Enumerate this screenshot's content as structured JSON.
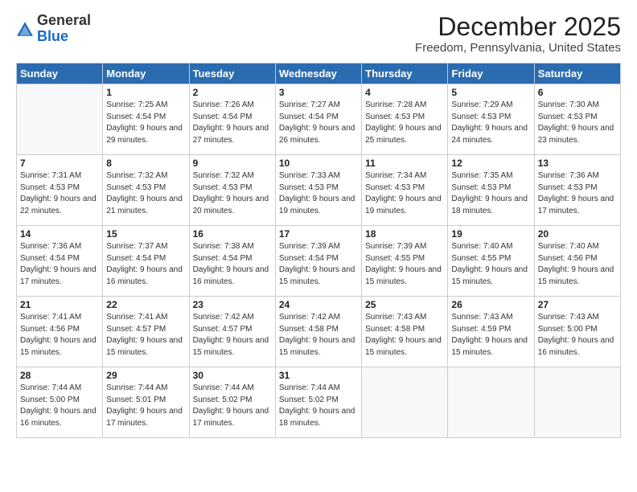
{
  "header": {
    "logo_general": "General",
    "logo_blue": "Blue",
    "month_title": "December 2025",
    "location": "Freedom, Pennsylvania, United States"
  },
  "days_of_week": [
    "Sunday",
    "Monday",
    "Tuesday",
    "Wednesday",
    "Thursday",
    "Friday",
    "Saturday"
  ],
  "weeks": [
    [
      {
        "day": "",
        "info": ""
      },
      {
        "day": "1",
        "info": "Sunrise: 7:25 AM\nSunset: 4:54 PM\nDaylight: 9 hours\nand 29 minutes."
      },
      {
        "day": "2",
        "info": "Sunrise: 7:26 AM\nSunset: 4:54 PM\nDaylight: 9 hours\nand 27 minutes."
      },
      {
        "day": "3",
        "info": "Sunrise: 7:27 AM\nSunset: 4:54 PM\nDaylight: 9 hours\nand 26 minutes."
      },
      {
        "day": "4",
        "info": "Sunrise: 7:28 AM\nSunset: 4:53 PM\nDaylight: 9 hours\nand 25 minutes."
      },
      {
        "day": "5",
        "info": "Sunrise: 7:29 AM\nSunset: 4:53 PM\nDaylight: 9 hours\nand 24 minutes."
      },
      {
        "day": "6",
        "info": "Sunrise: 7:30 AM\nSunset: 4:53 PM\nDaylight: 9 hours\nand 23 minutes."
      }
    ],
    [
      {
        "day": "7",
        "info": "Sunrise: 7:31 AM\nSunset: 4:53 PM\nDaylight: 9 hours\nand 22 minutes."
      },
      {
        "day": "8",
        "info": "Sunrise: 7:32 AM\nSunset: 4:53 PM\nDaylight: 9 hours\nand 21 minutes."
      },
      {
        "day": "9",
        "info": "Sunrise: 7:32 AM\nSunset: 4:53 PM\nDaylight: 9 hours\nand 20 minutes."
      },
      {
        "day": "10",
        "info": "Sunrise: 7:33 AM\nSunset: 4:53 PM\nDaylight: 9 hours\nand 19 minutes."
      },
      {
        "day": "11",
        "info": "Sunrise: 7:34 AM\nSunset: 4:53 PM\nDaylight: 9 hours\nand 19 minutes."
      },
      {
        "day": "12",
        "info": "Sunrise: 7:35 AM\nSunset: 4:53 PM\nDaylight: 9 hours\nand 18 minutes."
      },
      {
        "day": "13",
        "info": "Sunrise: 7:36 AM\nSunset: 4:53 PM\nDaylight: 9 hours\nand 17 minutes."
      }
    ],
    [
      {
        "day": "14",
        "info": "Sunrise: 7:36 AM\nSunset: 4:54 PM\nDaylight: 9 hours\nand 17 minutes."
      },
      {
        "day": "15",
        "info": "Sunrise: 7:37 AM\nSunset: 4:54 PM\nDaylight: 9 hours\nand 16 minutes."
      },
      {
        "day": "16",
        "info": "Sunrise: 7:38 AM\nSunset: 4:54 PM\nDaylight: 9 hours\nand 16 minutes."
      },
      {
        "day": "17",
        "info": "Sunrise: 7:39 AM\nSunset: 4:54 PM\nDaylight: 9 hours\nand 15 minutes."
      },
      {
        "day": "18",
        "info": "Sunrise: 7:39 AM\nSunset: 4:55 PM\nDaylight: 9 hours\nand 15 minutes."
      },
      {
        "day": "19",
        "info": "Sunrise: 7:40 AM\nSunset: 4:55 PM\nDaylight: 9 hours\nand 15 minutes."
      },
      {
        "day": "20",
        "info": "Sunrise: 7:40 AM\nSunset: 4:56 PM\nDaylight: 9 hours\nand 15 minutes."
      }
    ],
    [
      {
        "day": "21",
        "info": "Sunrise: 7:41 AM\nSunset: 4:56 PM\nDaylight: 9 hours\nand 15 minutes."
      },
      {
        "day": "22",
        "info": "Sunrise: 7:41 AM\nSunset: 4:57 PM\nDaylight: 9 hours\nand 15 minutes."
      },
      {
        "day": "23",
        "info": "Sunrise: 7:42 AM\nSunset: 4:57 PM\nDaylight: 9 hours\nand 15 minutes."
      },
      {
        "day": "24",
        "info": "Sunrise: 7:42 AM\nSunset: 4:58 PM\nDaylight: 9 hours\nand 15 minutes."
      },
      {
        "day": "25",
        "info": "Sunrise: 7:43 AM\nSunset: 4:58 PM\nDaylight: 9 hours\nand 15 minutes."
      },
      {
        "day": "26",
        "info": "Sunrise: 7:43 AM\nSunset: 4:59 PM\nDaylight: 9 hours\nand 15 minutes."
      },
      {
        "day": "27",
        "info": "Sunrise: 7:43 AM\nSunset: 5:00 PM\nDaylight: 9 hours\nand 16 minutes."
      }
    ],
    [
      {
        "day": "28",
        "info": "Sunrise: 7:44 AM\nSunset: 5:00 PM\nDaylight: 9 hours\nand 16 minutes."
      },
      {
        "day": "29",
        "info": "Sunrise: 7:44 AM\nSunset: 5:01 PM\nDaylight: 9 hours\nand 17 minutes."
      },
      {
        "day": "30",
        "info": "Sunrise: 7:44 AM\nSunset: 5:02 PM\nDaylight: 9 hours\nand 17 minutes."
      },
      {
        "day": "31",
        "info": "Sunrise: 7:44 AM\nSunset: 5:02 PM\nDaylight: 9 hours\nand 18 minutes."
      },
      {
        "day": "",
        "info": ""
      },
      {
        "day": "",
        "info": ""
      },
      {
        "day": "",
        "info": ""
      }
    ]
  ]
}
